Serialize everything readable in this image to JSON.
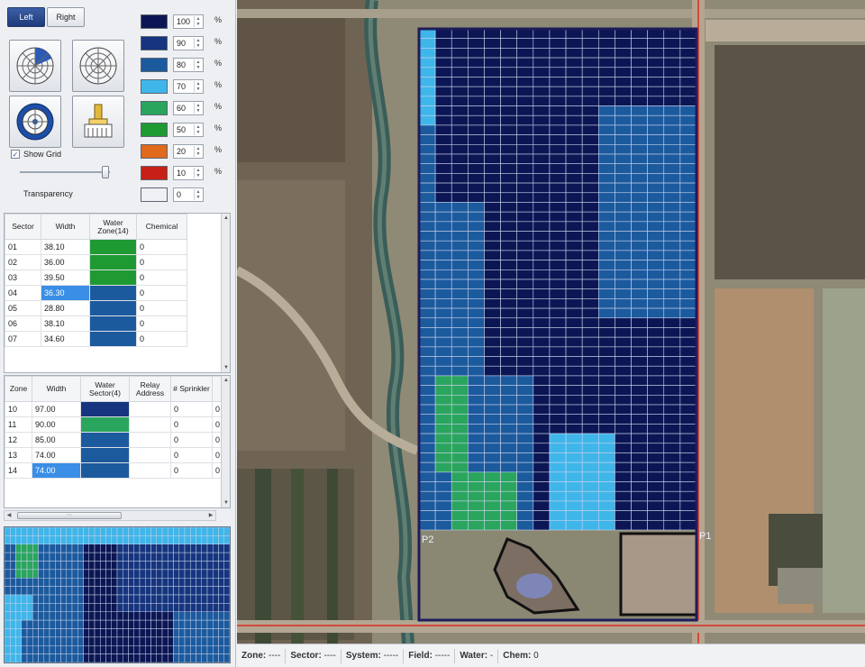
{
  "toolbar": {
    "left_label": "Left",
    "right_label": "Right"
  },
  "icons": [
    "sector-selection-icon",
    "radial-grid-icon",
    "center-target-icon",
    "paint-brush-icon"
  ],
  "legend": [
    {
      "color": "#0c1654",
      "value": "100",
      "unit": "%"
    },
    {
      "color": "#16357e",
      "value": "90",
      "unit": "%"
    },
    {
      "color": "#1c5a9e",
      "value": "80",
      "unit": "%"
    },
    {
      "color": "#3fb6ea",
      "value": "70",
      "unit": "%"
    },
    {
      "color": "#2aa55e",
      "value": "60",
      "unit": "%"
    },
    {
      "color": "#1f9a33",
      "value": "50",
      "unit": "%"
    },
    {
      "color": "#e0691c",
      "value": "20",
      "unit": "%"
    },
    {
      "color": "#c81f16",
      "value": "10",
      "unit": "%"
    },
    {
      "color": "#eef0f4",
      "value": "0",
      "unit": ""
    }
  ],
  "show_grid": {
    "label": "Show Grid",
    "checked": true
  },
  "transparency": {
    "label": "Transparency",
    "level": 0.95
  },
  "sector_table": {
    "headers": [
      "Sector",
      "Width",
      "Water Zone(14)",
      "Chemical"
    ],
    "rows": [
      {
        "sector": "01",
        "width": "38.10",
        "zone_color": "#1f9a33",
        "zone": "",
        "chemical": "0"
      },
      {
        "sector": "02",
        "width": "36.00",
        "zone_color": "#1f9a33",
        "zone": "",
        "chemical": "0"
      },
      {
        "sector": "03",
        "width": "39.50",
        "zone_color": "#1f9a33",
        "zone": "",
        "chemical": "0"
      },
      {
        "sector": "04",
        "width": "36.30",
        "zone_color": "#1c5a9e",
        "zone": "",
        "chemical": "0",
        "selected": true
      },
      {
        "sector": "05",
        "width": "28.80",
        "zone_color": "#1c5a9e",
        "zone": "",
        "chemical": "0"
      },
      {
        "sector": "06",
        "width": "38.10",
        "zone_color": "#1c5a9e",
        "zone": "",
        "chemical": "0"
      },
      {
        "sector": "07",
        "width": "34.60",
        "zone_color": "#1c5a9e",
        "zone": "",
        "chemical": "0"
      }
    ]
  },
  "zone_table": {
    "headers": [
      "Zone",
      "Width",
      "Water Sector(4)",
      "Relay Address",
      "# Sprinkler",
      ""
    ],
    "rows": [
      {
        "zone": "10",
        "width": "97.00",
        "sector_color": "#16357e",
        "relay": "",
        "sprinkler": "0",
        "extra": "0"
      },
      {
        "zone": "11",
        "width": "90.00",
        "sector_color": "#2aa55e",
        "relay": "",
        "sprinkler": "0",
        "extra": "0"
      },
      {
        "zone": "12",
        "width": "85.00",
        "sector_color": "#1c5a9e",
        "relay": "",
        "sprinkler": "0",
        "extra": "0"
      },
      {
        "zone": "13",
        "width": "74.00",
        "sector_color": "#1c5a9e",
        "relay": "",
        "sprinkler": "0",
        "extra": "0"
      },
      {
        "zone": "14",
        "width": "74.00",
        "sector_color": "#1c5a9e",
        "relay": "",
        "sprinkler": "0",
        "extra": "0",
        "selected": true
      }
    ]
  },
  "map": {
    "point_labels": {
      "p2": "P2",
      "p1": "P1"
    },
    "grid_rows": 52,
    "grid_cols": 17,
    "zone_map": [
      "ABBBBBBBBBBBBBBBB",
      "ABBBBBBBBBBBBBBBB",
      "ACCCCBBBBBBBBBBBB",
      "ACCCBBBBBBBBBBBBB",
      "ACCCBBBBBBBBBBBBB",
      "ACCCBBBBBBBBBBBBB",
      "ACCCBBBBBBBBBBBBB",
      "ACCCBBBBBBBBBBBBB",
      "ACCCBBBBBBBBBBBBB",
      "ACCCBBBBBBBBBBBBB",
      "DCCCBBBBBBBBBBBBB",
      "DCCCBBBBBBBBBBBBB",
      "DCCCBBBBBBBBBBBBB",
      "DCCCBBBBBBBBBBBBB",
      "DCCCBBBBBBBBBBBBB",
      "DCCCBBBBBBBBBBBBB",
      "DCCCBBBBBBBBBBBBB",
      "DCCCBBBBBBBBBBBBB",
      "DDDDBBBBBBBBBBBBB",
      "DDDDBBBBBBBBBBBBB",
      "DDDDBBBBBBBBBBBBB",
      "DDDDBBBBBBBBBBBBB",
      "DDDDBBBBBBBBBBBBB",
      "DDDDBBBBBBBBBBBBB",
      "DDDDBBBBBBBBBBBBB",
      "DDDDBBBBBBBBBBBBB",
      "DDDDBBBBBBBBBBBBB",
      "DDDDBBBBBBBBBBBBB",
      "DDDDBBBBBBBBBBBBB",
      "DDDDBBBBBBBBBBBBB",
      "DDDDBBBBBBBBBBBBB",
      "DDDDBBBBBBBBBBBBB",
      "DDDDBBBBBBBBBBBBB",
      "DDDDBBBBBBBBBBBBB",
      "DDDDBBBBBBBBBBBBB",
      "DDDDBBBBBBBBBBBBB",
      "DEEEEEEBBBBBBBBBB",
      "DEEEEEEBBBBBBBBBB",
      "DEEEEEEBBBBBBBBBB",
      "DEEEEEEBBBBBBBBBB",
      "DEEEEEEBBBBBBBBBB",
      "DEEEEEEBBBBBBBBBB",
      "DEEEEEEBBBBBBBBBB",
      "DEEEEEEBBBBBBBBBB",
      "DEEEEEEBBBBBBBBBB",
      "DEEEEEEBBBBBBBBBB",
      "DEEEEEEBBBBBBBBBB",
      "DEEEEEEBBBBBBBBBB",
      "DEEEEEEBBBBBBBBBB",
      "DEEEEEEBBBBBBBBBB",
      "DEEEEEEBBBBBBBBBB",
      "DEEEEEEBBBBBBBBBB"
    ],
    "zone_colors": {
      "A": "#3fb6ea",
      "B": "#0c1654",
      "C": "#0c1654",
      "D": "#1c5a9e",
      "E": "#1c5a9e"
    }
  },
  "status_bar": {
    "zone_label": "Zone:",
    "zone_value": "----",
    "sector_label": "Sector:",
    "sector_value": "----",
    "system_label": "System:",
    "system_value": "-----",
    "field_label": "Field:",
    "field_value": "-----",
    "water_label": "Water:",
    "water_value": "-",
    "chem_label": "Chem:",
    "chem_value": "0"
  }
}
